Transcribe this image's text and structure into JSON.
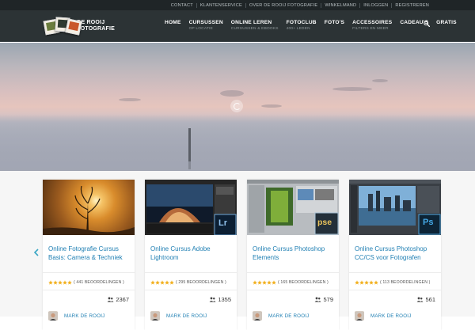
{
  "topbar": {
    "links": [
      "CONTACT",
      "KLANTENSERVICE",
      "OVER DE ROOIJ FOTOGRAFIE",
      "WINKELMAND",
      "INLOGGEN",
      "REGISTREREN"
    ]
  },
  "logo": {
    "line1": "DE ROOIJ",
    "line2": "FOTOGRAFIE"
  },
  "nav": {
    "items": [
      {
        "label": "HOME",
        "sub": ""
      },
      {
        "label": "CURSUSSEN",
        "sub": "OP LOCATIE"
      },
      {
        "label": "ONLINE LEREN",
        "sub": "CURSUSSEN & EBOOKS"
      },
      {
        "label": "FOTOCLUB",
        "sub": "400+ LEDEN"
      },
      {
        "label": "FOTO'S",
        "sub": ""
      },
      {
        "label": "ACCESSOIRES",
        "sub": "FILTERS EN MEER"
      },
      {
        "label": "CADEAU'S",
        "sub": ""
      },
      {
        "label": "GRATIS",
        "sub": ""
      }
    ],
    "search_icon": "search-icon"
  },
  "colors": {
    "topbar": "#1f2527",
    "header": "#2c3335",
    "link": "#1f7fb3",
    "star": "#f2b01e"
  },
  "courses": [
    {
      "title": "Online Fotografie Cursus Basis: Camera & Techniek",
      "rating_text": "( 441 BEOORDELINGEN )",
      "stars": 5,
      "students": "2367",
      "author": "MARK DE ROOIJ"
    },
    {
      "title": "Online Cursus Adobe Lightroom",
      "rating_text": "( 295 BEOORDELINGEN )",
      "stars": 5,
      "students": "1355",
      "author": "MARK DE ROOIJ",
      "badge": "Lr"
    },
    {
      "title": "Online Cursus Photoshop Elements",
      "rating_text": "( 165 BEOORDELINGEN )",
      "stars": 5,
      "students": "579",
      "author": "MARK DE ROOIJ",
      "badge": "pse"
    },
    {
      "title": "Online Cursus Photoshop CC/CS voor Fotografen",
      "rating_text": "( 113 BEOORDELINGEN )",
      "stars": 5,
      "students": "561",
      "author": "MARK DE ROOIJ",
      "badge": "Ps"
    }
  ]
}
